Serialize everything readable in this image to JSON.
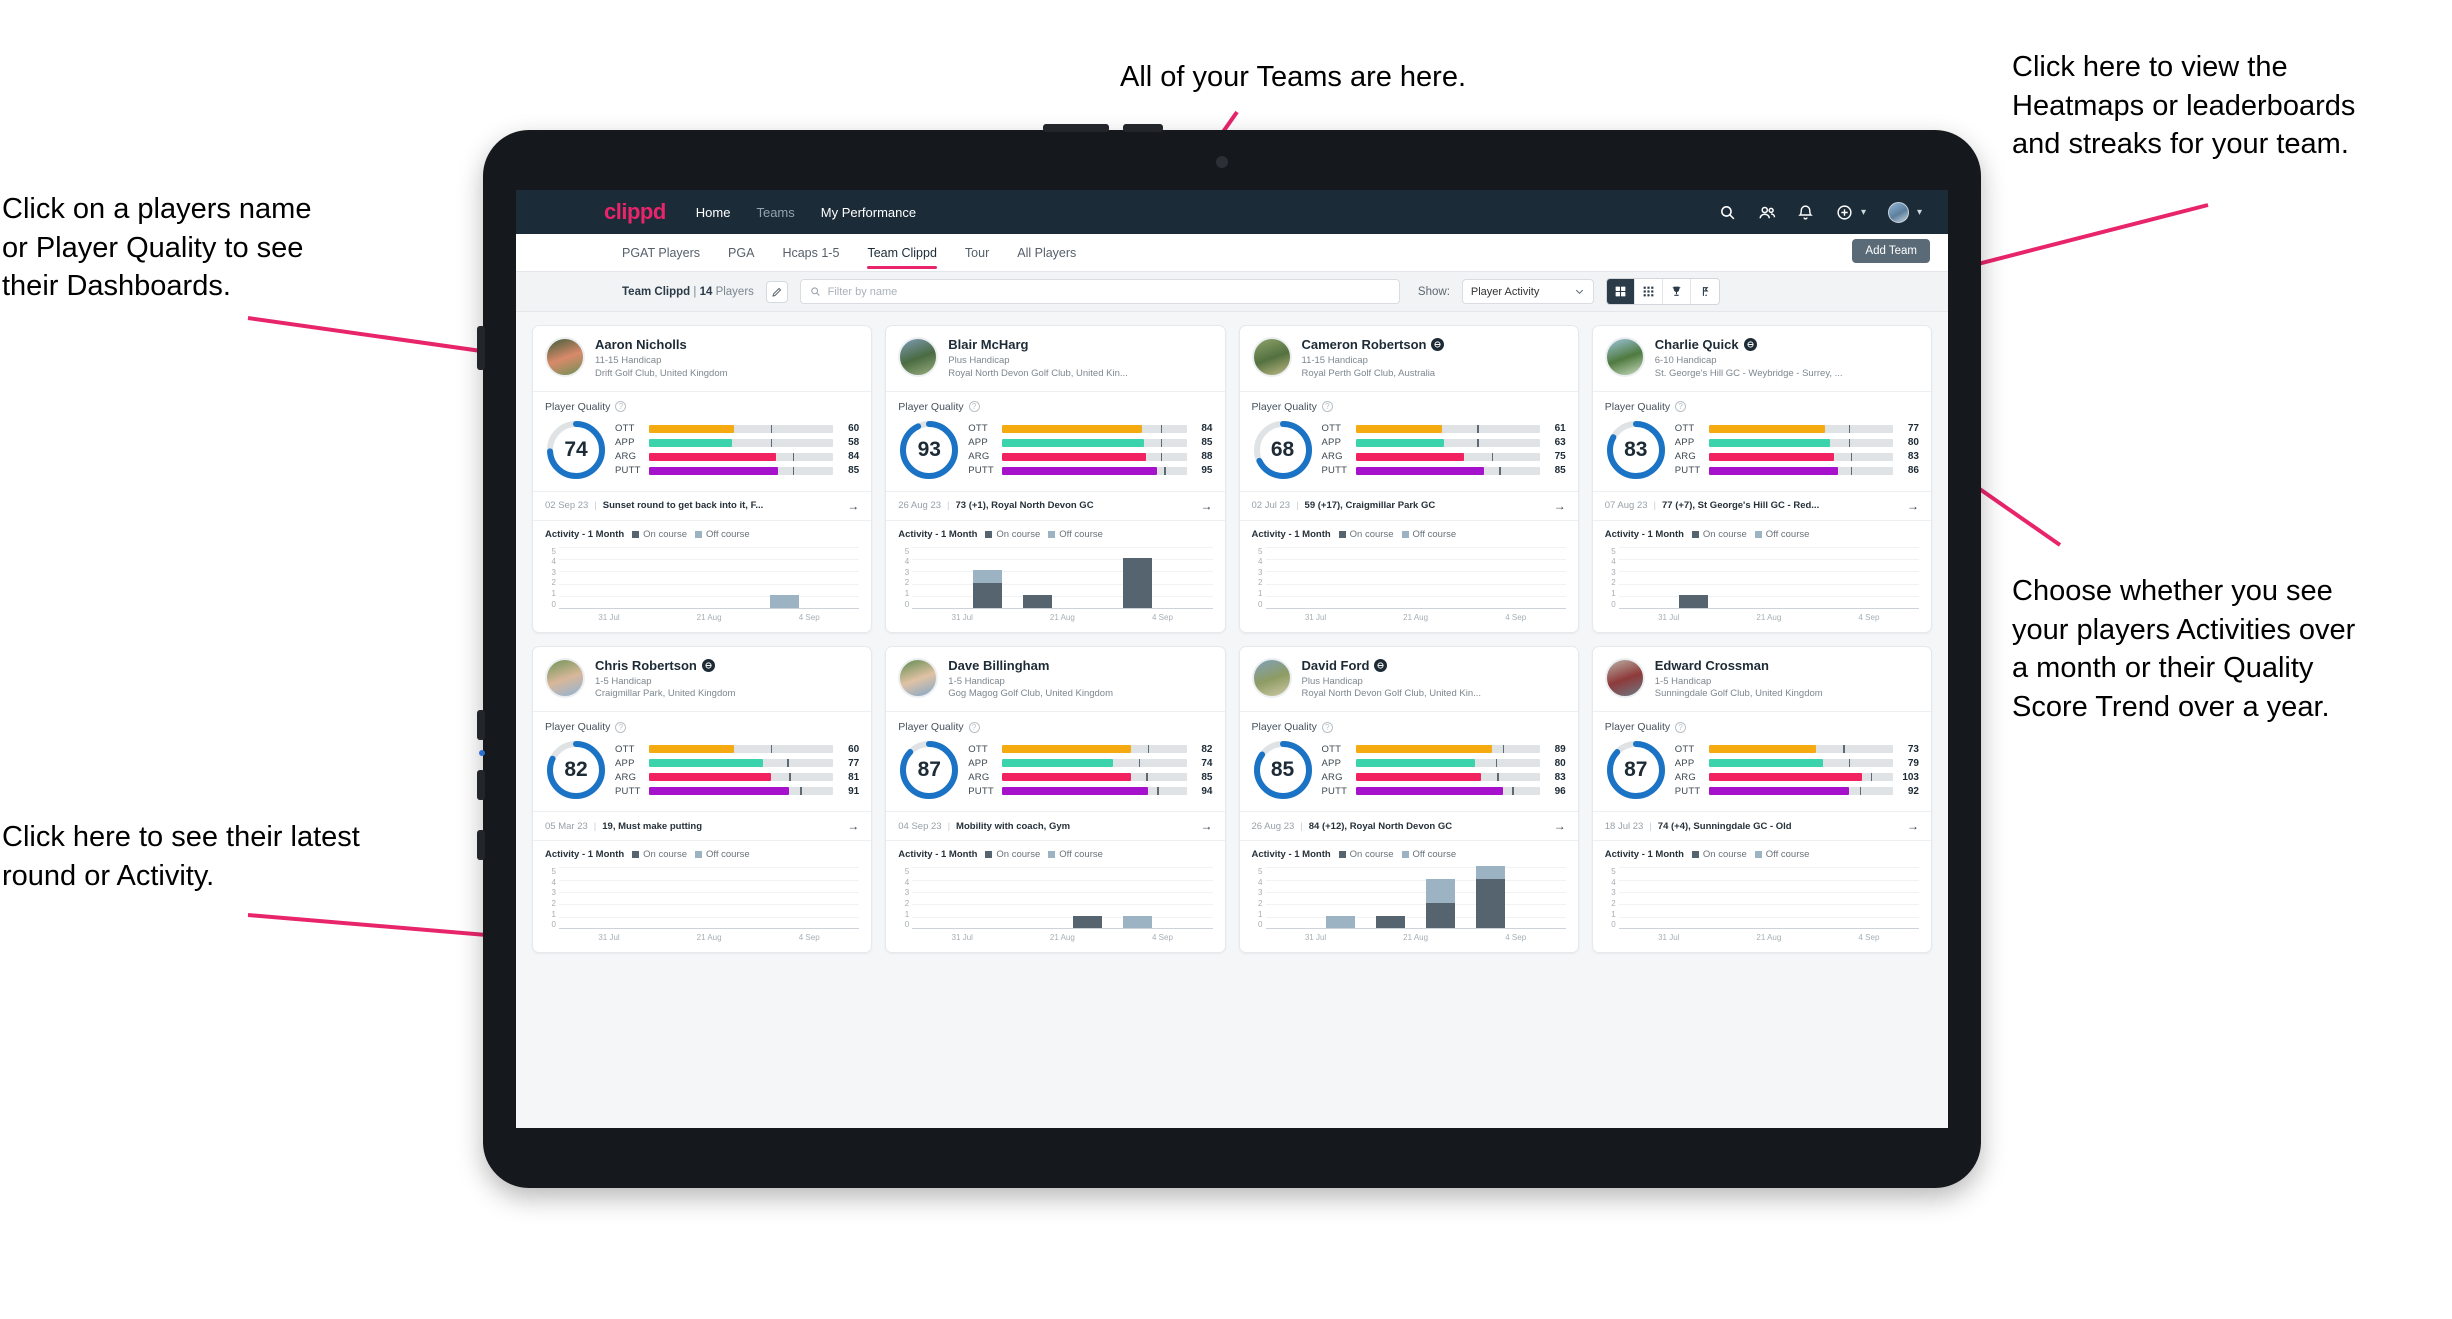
{
  "annotations": {
    "top_left": "Click on a players name\nor Player Quality to see\ntheir Dashboards.",
    "top_center": "All of your Teams are here.",
    "top_right": "Click here to view the\nHeatmaps or leaderboards\nand streaks for your team.",
    "bottom_left": "Click here to see their latest\nround or Activity.",
    "bottom_right": "Choose whether you see\nyour players Activities over\na month or their Quality\nScore Trend over a year.",
    "arrow_color": "#e8246a"
  },
  "topnav": {
    "brand": "clippd",
    "links": [
      {
        "label": "Home",
        "active": true
      },
      {
        "label": "Teams",
        "active": false
      },
      {
        "label": "My Performance",
        "active": true
      }
    ],
    "icons": [
      "search-icon",
      "people-icon",
      "bell-icon",
      "plus-circle-icon",
      "avatar"
    ]
  },
  "tabbar": {
    "tabs": [
      {
        "label": "PGAT Players",
        "active": false
      },
      {
        "label": "PGA",
        "active": false
      },
      {
        "label": "Hcaps 1-5",
        "active": false
      },
      {
        "label": "Team Clippd",
        "active": true
      },
      {
        "label": "Tour",
        "active": false
      },
      {
        "label": "All Players",
        "active": false
      }
    ],
    "add_team_label": "Add Team"
  },
  "filterbar": {
    "team_name": "Team Clippd",
    "separator": "|",
    "player_count": "14",
    "players_word": "Players",
    "edit_icon": "pencil-icon",
    "search_placeholder": "Filter by name",
    "search_value": "",
    "show_label": "Show:",
    "show_value": "Player Activity",
    "show_options": [
      "Player Activity",
      "Quality Score Trend"
    ],
    "view_buttons": [
      {
        "name": "grid-large-view",
        "active": true
      },
      {
        "name": "grid-small-view",
        "active": false
      },
      {
        "name": "trophy-leaderboard-view",
        "active": false
      },
      {
        "name": "flag-heatmap-view",
        "active": false
      }
    ]
  },
  "card_labels": {
    "player_quality": "Player Quality",
    "activity": "Activity - 1 Month",
    "legend_on": "On course",
    "legend_off": "Off course",
    "skills": [
      "OTT",
      "APP",
      "ARG",
      "PUTT"
    ],
    "y_ticks": [
      "5",
      "4",
      "3",
      "2",
      "1",
      "0"
    ],
    "x_ticks": [
      "31 Jul",
      "21 Aug",
      "4 Sep"
    ],
    "arrow": "→"
  },
  "colors": {
    "ott": "#f5aa11",
    "app": "#3ad3ab",
    "arg": "#f2215f",
    "putt": "#a612cc",
    "ring": "#1a73c4",
    "on_course": "#55646f",
    "off_course": "#9cb3c4",
    "accent": "#e8246a",
    "navy": "#1b2b38"
  },
  "players": [
    {
      "name": "Aaron Nicholls",
      "verified": false,
      "handicap": "11-15 Handicap",
      "club": "Drift Golf Club, United Kingdom",
      "quality": 74,
      "avatar_colors": [
        "#3f5d3a",
        "#d98a6a",
        "#6d8f55"
      ],
      "skills": [
        {
          "key": "OTT",
          "value": 60,
          "fill": 46,
          "tick": 66
        },
        {
          "key": "APP",
          "value": 58,
          "fill": 45,
          "tick": 66
        },
        {
          "key": "ARG",
          "value": 84,
          "fill": 69,
          "tick": 78
        },
        {
          "key": "PUTT",
          "value": 85,
          "fill": 70,
          "tick": 78
        }
      ],
      "round": {
        "date": "02 Sep 23",
        "text": "Sunset round to get back into it, F..."
      },
      "chart": {
        "type": "bar",
        "stacked": true,
        "x": [
          "31 Jul",
          "21 Aug",
          "4 Sep"
        ],
        "ylim": [
          0,
          5
        ],
        "bars": [
          {
            "on": 0,
            "off": 0
          },
          {
            "on": 0,
            "off": 0
          },
          {
            "on": 0,
            "off": 0
          },
          {
            "on": 0,
            "off": 0
          },
          {
            "on": 0,
            "off": 1
          },
          {
            "on": 0,
            "off": 0
          }
        ]
      }
    },
    {
      "name": "Blair McHarg",
      "verified": false,
      "handicap": "Plus Handicap",
      "club": "Royal North Devon Golf Club, United Kin...",
      "quality": 93,
      "avatar_colors": [
        "#7e9bb5",
        "#4a6b42",
        "#9aae7f"
      ],
      "skills": [
        {
          "key": "OTT",
          "value": 84,
          "fill": 76,
          "tick": 86
        },
        {
          "key": "APP",
          "value": 85,
          "fill": 77,
          "tick": 86
        },
        {
          "key": "ARG",
          "value": 88,
          "fill": 78,
          "tick": 86
        },
        {
          "key": "PUTT",
          "value": 95,
          "fill": 84,
          "tick": 88
        }
      ],
      "round": {
        "date": "26 Aug 23",
        "text": "73 (+1), Royal North Devon GC"
      },
      "chart": {
        "type": "bar",
        "stacked": true,
        "x": [
          "31 Jul",
          "21 Aug",
          "4 Sep"
        ],
        "ylim": [
          0,
          5
        ],
        "bars": [
          {
            "on": 0,
            "off": 0
          },
          {
            "on": 2,
            "off": 1
          },
          {
            "on": 1,
            "off": 0
          },
          {
            "on": 0,
            "off": 0
          },
          {
            "on": 4,
            "off": 0
          },
          {
            "on": 0,
            "off": 0
          }
        ]
      }
    },
    {
      "name": "Cameron Robertson",
      "verified": true,
      "handicap": "11-15 Handicap",
      "club": "Royal Perth Golf Club, Australia",
      "quality": 68,
      "avatar_colors": [
        "#8fa36b",
        "#53713f",
        "#c2ba86"
      ],
      "skills": [
        {
          "key": "OTT",
          "value": 61,
          "fill": 47,
          "tick": 66
        },
        {
          "key": "APP",
          "value": 63,
          "fill": 48,
          "tick": 66
        },
        {
          "key": "ARG",
          "value": 75,
          "fill": 59,
          "tick": 74
        },
        {
          "key": "PUTT",
          "value": 85,
          "fill": 70,
          "tick": 78
        }
      ],
      "round": {
        "date": "02 Jul 23",
        "text": "59 (+17), Craigmillar Park GC"
      },
      "chart": {
        "type": "bar",
        "stacked": true,
        "x": [
          "31 Jul",
          "21 Aug",
          "4 Sep"
        ],
        "ylim": [
          0,
          5
        ],
        "bars": [
          {
            "on": 0,
            "off": 0
          },
          {
            "on": 0,
            "off": 0
          },
          {
            "on": 0,
            "off": 0
          },
          {
            "on": 0,
            "off": 0
          },
          {
            "on": 0,
            "off": 0
          },
          {
            "on": 0,
            "off": 0
          }
        ]
      }
    },
    {
      "name": "Charlie Quick",
      "verified": true,
      "handicap": "6-10 Handicap",
      "club": "St. George's Hill GC - Weybridge - Surrey, ...",
      "quality": 83,
      "avatar_colors": [
        "#9ec5dd",
        "#4f7a3f",
        "#c8dcc0"
      ],
      "skills": [
        {
          "key": "OTT",
          "value": 77,
          "fill": 63,
          "tick": 76
        },
        {
          "key": "APP",
          "value": 80,
          "fill": 66,
          "tick": 76
        },
        {
          "key": "ARG",
          "value": 83,
          "fill": 68,
          "tick": 77
        },
        {
          "key": "PUTT",
          "value": 86,
          "fill": 70,
          "tick": 77
        }
      ],
      "round": {
        "date": "07 Aug 23",
        "text": "77 (+7), St George's Hill GC - Red..."
      },
      "chart": {
        "type": "bar",
        "stacked": true,
        "x": [
          "31 Jul",
          "21 Aug",
          "4 Sep"
        ],
        "ylim": [
          0,
          5
        ],
        "bars": [
          {
            "on": 0,
            "off": 0
          },
          {
            "on": 1,
            "off": 0
          },
          {
            "on": 0,
            "off": 0
          },
          {
            "on": 0,
            "off": 0
          },
          {
            "on": 0,
            "off": 0
          },
          {
            "on": 0,
            "off": 0
          }
        ]
      }
    },
    {
      "name": "Chris Robertson",
      "verified": true,
      "handicap": "1-5 Handicap",
      "club": "Craigmillar Park, United Kingdom",
      "quality": 82,
      "avatar_colors": [
        "#6f9456",
        "#d8b79a",
        "#8fb3d6"
      ],
      "skills": [
        {
          "key": "OTT",
          "value": 60,
          "fill": 46,
          "tick": 66
        },
        {
          "key": "APP",
          "value": 77,
          "fill": 62,
          "tick": 75
        },
        {
          "key": "ARG",
          "value": 81,
          "fill": 66,
          "tick": 76
        },
        {
          "key": "PUTT",
          "value": 91,
          "fill": 76,
          "tick": 82
        }
      ],
      "round": {
        "date": "05 Mar 23",
        "text": "19, Must make putting"
      },
      "chart": {
        "type": "bar",
        "stacked": true,
        "x": [
          "31 Jul",
          "21 Aug",
          "4 Sep"
        ],
        "ylim": [
          0,
          5
        ],
        "bars": [
          {
            "on": 0,
            "off": 0
          },
          {
            "on": 0,
            "off": 0
          },
          {
            "on": 0,
            "off": 0
          },
          {
            "on": 0,
            "off": 0
          },
          {
            "on": 0,
            "off": 0
          },
          {
            "on": 0,
            "off": 0
          }
        ]
      }
    },
    {
      "name": "Dave Billingham",
      "verified": false,
      "handicap": "1-5 Handicap",
      "club": "Gog Magog Golf Club, United Kingdom",
      "quality": 87,
      "avatar_colors": [
        "#5f8a4f",
        "#e0c2a4",
        "#7fa7c9"
      ],
      "skills": [
        {
          "key": "OTT",
          "value": 82,
          "fill": 70,
          "tick": 79
        },
        {
          "key": "APP",
          "value": 74,
          "fill": 60,
          "tick": 74
        },
        {
          "key": "ARG",
          "value": 85,
          "fill": 70,
          "tick": 78
        },
        {
          "key": "PUTT",
          "value": 94,
          "fill": 79,
          "tick": 84
        }
      ],
      "round": {
        "date": "04 Sep 23",
        "text": "Mobility with coach, Gym"
      },
      "chart": {
        "type": "bar",
        "stacked": true,
        "x": [
          "31 Jul",
          "21 Aug",
          "4 Sep"
        ],
        "ylim": [
          0,
          5
        ],
        "bars": [
          {
            "on": 0,
            "off": 0
          },
          {
            "on": 0,
            "off": 0
          },
          {
            "on": 0,
            "off": 0
          },
          {
            "on": 1,
            "off": 0
          },
          {
            "on": 0,
            "off": 1
          },
          {
            "on": 0,
            "off": 0
          }
        ]
      }
    },
    {
      "name": "David Ford",
      "verified": true,
      "handicap": "Plus Handicap",
      "club": "Royal North Devon Golf Club, United Kin...",
      "quality": 85,
      "avatar_colors": [
        "#7fa0bb",
        "#8e9c63",
        "#d0c9a8"
      ],
      "skills": [
        {
          "key": "OTT",
          "value": 89,
          "fill": 74,
          "tick": 80
        },
        {
          "key": "APP",
          "value": 80,
          "fill": 65,
          "tick": 76
        },
        {
          "key": "ARG",
          "value": 83,
          "fill": 68,
          "tick": 77
        },
        {
          "key": "PUTT",
          "value": 96,
          "fill": 80,
          "tick": 85
        }
      ],
      "round": {
        "date": "26 Aug 23",
        "text": "84 (+12), Royal North Devon GC"
      },
      "chart": {
        "type": "bar",
        "stacked": true,
        "x": [
          "31 Jul",
          "21 Aug",
          "4 Sep"
        ],
        "ylim": [
          0,
          5
        ],
        "bars": [
          {
            "on": 0,
            "off": 0
          },
          {
            "on": 0,
            "off": 1
          },
          {
            "on": 1,
            "off": 0
          },
          {
            "on": 2,
            "off": 2
          },
          {
            "on": 4,
            "off": 1
          },
          {
            "on": 0,
            "off": 0
          }
        ]
      }
    },
    {
      "name": "Edward Crossman",
      "verified": false,
      "handicap": "1-5 Handicap",
      "club": "Sunningdale Golf Club, United Kingdom",
      "quality": 87,
      "avatar_colors": [
        "#b9b2a6",
        "#8e3a3a",
        "#6d7a86"
      ],
      "skills": [
        {
          "key": "OTT",
          "value": 73,
          "fill": 58,
          "tick": 73
        },
        {
          "key": "APP",
          "value": 79,
          "fill": 62,
          "tick": 76
        },
        {
          "key": "ARG",
          "value": 103,
          "fill": 83,
          "tick": 88
        },
        {
          "key": "PUTT",
          "value": 92,
          "fill": 76,
          "tick": 82
        }
      ],
      "round": {
        "date": "18 Jul 23",
        "text": "74 (+4), Sunningdale GC - Old"
      },
      "chart": {
        "type": "bar",
        "stacked": true,
        "x": [
          "31 Jul",
          "21 Aug",
          "4 Sep"
        ],
        "ylim": [
          0,
          5
        ],
        "bars": [
          {
            "on": 0,
            "off": 0
          },
          {
            "on": 0,
            "off": 0
          },
          {
            "on": 0,
            "off": 0
          },
          {
            "on": 0,
            "off": 0
          },
          {
            "on": 0,
            "off": 0
          },
          {
            "on": 0,
            "off": 0
          }
        ]
      }
    }
  ]
}
